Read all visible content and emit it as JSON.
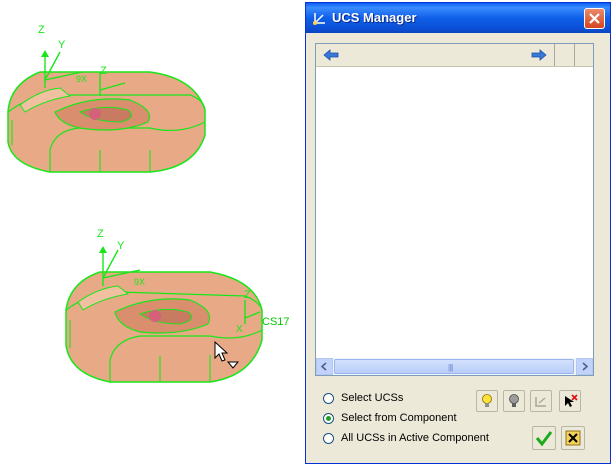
{
  "viewport": {
    "ucs_label": "CS17",
    "axis_labels": {
      "z": "Z",
      "y": "Y",
      "x": "X"
    }
  },
  "dialog": {
    "title": "UCS Manager",
    "icons": {
      "title": "ucs-axes-icon",
      "close": "close-icon",
      "back": "left-arrow-icon",
      "forward": "right-arrow-icon"
    },
    "radio_options": [
      {
        "label": "Select UCSs",
        "selected": false
      },
      {
        "label": "Select from Component",
        "selected": true
      },
      {
        "label": "All UCSs in Active Component",
        "selected": false
      }
    ],
    "tool_buttons": [
      "bulb-on-icon",
      "bulb-off-icon",
      "ucs-align-icon",
      "delete-pick-icon"
    ],
    "ok_icon": "checkmark-icon",
    "cancel_icon": "cancel-x-icon",
    "colors": {
      "accent": "#0a5ef0",
      "model": "#e8aa86",
      "wire": "#19e619"
    }
  }
}
